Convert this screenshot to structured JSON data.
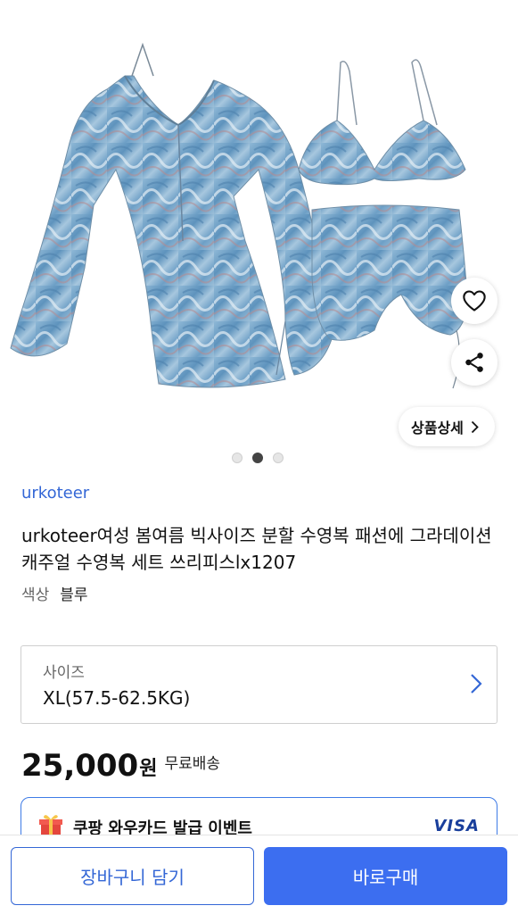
{
  "gallery": {
    "dots_total": 3,
    "active_index": 1,
    "detail_label": "상품상세"
  },
  "product": {
    "brand": "urkoteer",
    "title": "urkoteer여성 봄여름 빅사이즈 분할 수영복 패션에 그라데이션 캐주얼 수영복 세트 쓰리피스lx1207",
    "color_label": "색상",
    "color_value": "블루"
  },
  "size": {
    "label": "사이즈",
    "value": "XL(57.5-62.5KG)"
  },
  "price": {
    "amount": "25,000",
    "unit": "원",
    "shipping": "무료배송"
  },
  "promo": {
    "text": "쿠팡 와우카드 발급 이벤트",
    "card_brand": "VISA"
  },
  "actions": {
    "cart_label": "장바구니 담기",
    "buy_label": "바로구매"
  },
  "colors": {
    "accent": "#3c6ef0",
    "brand_link": "#3467d6",
    "garment": "#7aa9c9"
  },
  "icons": [
    "heart-icon",
    "share-icon",
    "chevron-right-icon",
    "gift-icon"
  ]
}
